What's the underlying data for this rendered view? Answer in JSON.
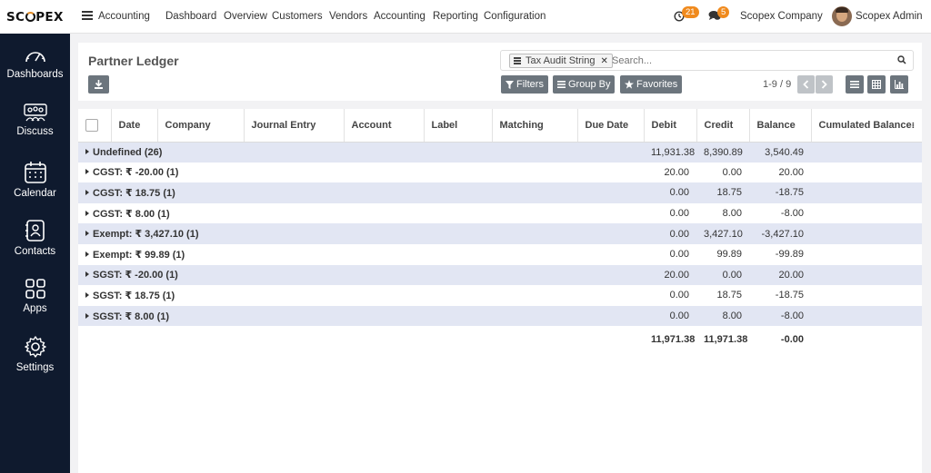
{
  "brand": {
    "logo_part1": "SC",
    "logo_part2": "PEX"
  },
  "sidebar": {
    "items": [
      {
        "label": "Dashboards",
        "icon": "speedometer-icon"
      },
      {
        "label": "Discuss",
        "icon": "people-icon"
      },
      {
        "label": "Calendar",
        "icon": "calendar-icon"
      },
      {
        "label": "Contacts",
        "icon": "contacts-book-icon"
      },
      {
        "label": "Apps",
        "icon": "apps-grid-icon"
      },
      {
        "label": "Settings",
        "icon": "gear-icon"
      }
    ]
  },
  "topbar": {
    "app_name": "Accounting",
    "menu": [
      "Dashboard",
      "Overview",
      "Customers",
      "Vendors",
      "Accounting",
      "Reporting",
      "Configuration"
    ],
    "activity_count": "21",
    "message_count": "5",
    "company": "Scopex Company",
    "user": "Scopex Admin"
  },
  "control": {
    "title": "Partner Ledger",
    "facet_label": "Tax Audit String",
    "search_placeholder": "Search...",
    "filters_label": "Filters",
    "groupby_label": "Group By",
    "favorites_label": "Favorites",
    "pager": "1-9 / 9"
  },
  "table": {
    "columns": [
      "Date",
      "Company",
      "Journal Entry",
      "Account",
      "Label",
      "Matching",
      "Due Date",
      "Debit",
      "Credit",
      "Balance",
      "Cumulated Balance"
    ],
    "groups": [
      {
        "name": "Undefined (26)",
        "debit": "11,931.38",
        "credit": "8,390.89",
        "balance": "3,540.49"
      },
      {
        "name": "CGST: ₹ -20.00 (1)",
        "debit": "20.00",
        "credit": "0.00",
        "balance": "20.00"
      },
      {
        "name": "CGST: ₹ 18.75 (1)",
        "debit": "0.00",
        "credit": "18.75",
        "balance": "-18.75"
      },
      {
        "name": "CGST: ₹ 8.00 (1)",
        "debit": "0.00",
        "credit": "8.00",
        "balance": "-8.00"
      },
      {
        "name": "Exempt: ₹ 3,427.10 (1)",
        "debit": "0.00",
        "credit": "3,427.10",
        "balance": "-3,427.10"
      },
      {
        "name": "Exempt: ₹ 99.89 (1)",
        "debit": "0.00",
        "credit": "99.89",
        "balance": "-99.89"
      },
      {
        "name": "SGST: ₹ -20.00 (1)",
        "debit": "20.00",
        "credit": "0.00",
        "balance": "20.00"
      },
      {
        "name": "SGST: ₹ 18.75 (1)",
        "debit": "0.00",
        "credit": "18.75",
        "balance": "-18.75"
      },
      {
        "name": "SGST: ₹ 8.00 (1)",
        "debit": "0.00",
        "credit": "8.00",
        "balance": "-8.00"
      }
    ],
    "totals": {
      "debit": "11,971.38",
      "credit": "11,971.38",
      "balance": "-0.00"
    }
  },
  "colors": {
    "sidebar_bg": "#0f1a2e",
    "band_row": "#e2e6f3",
    "badge": "#f08a1d",
    "button": "#6c757d"
  }
}
